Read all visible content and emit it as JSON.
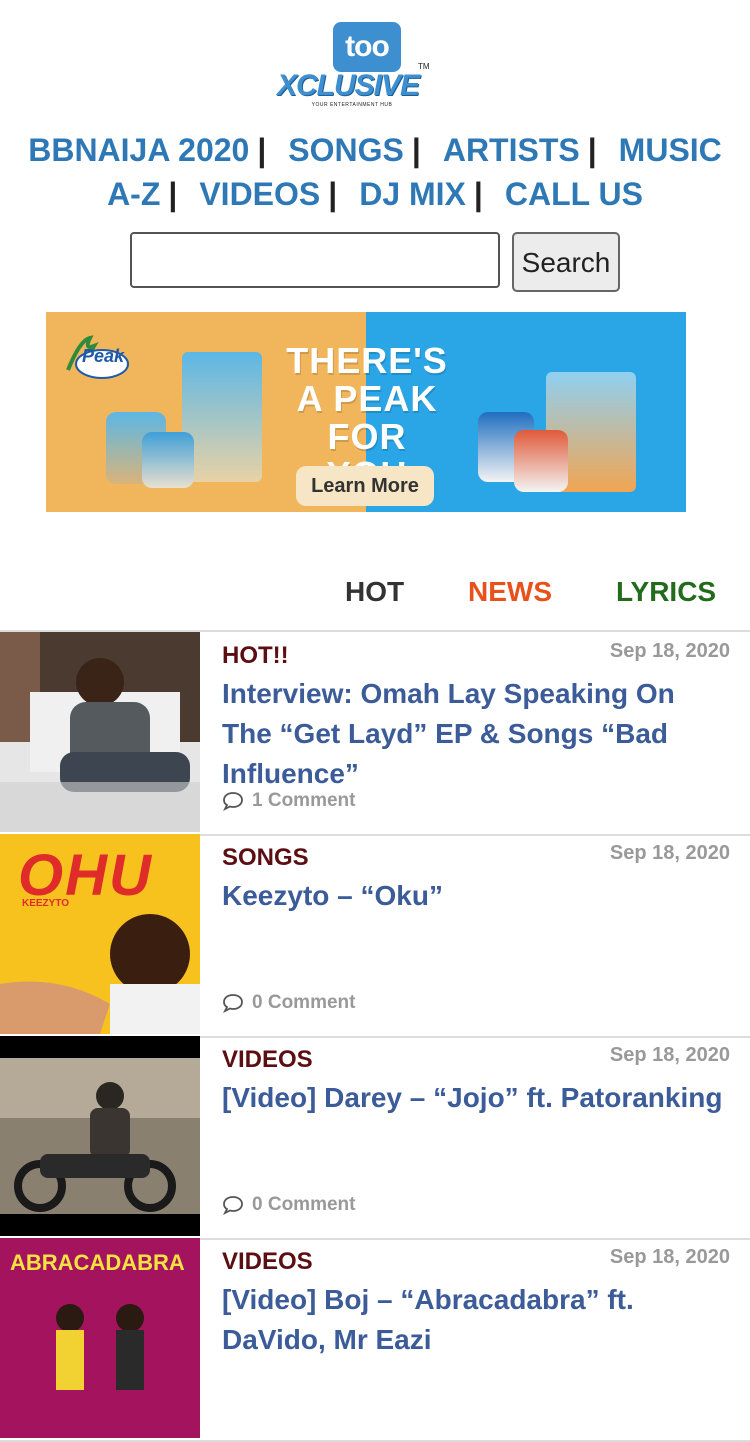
{
  "logo": {
    "top_text": "too",
    "main_text": "XCLUSIVE",
    "tm": "TM",
    "tagline": "YOUR ENTERTAINMENT HUB"
  },
  "nav": {
    "items": [
      "BBNAIJA 2020",
      "SONGS",
      "ARTISTS",
      "MUSIC A-Z",
      "VIDEOS",
      "DJ MIX",
      "CALL US"
    ],
    "line1": [
      "BBNAIJA 2020",
      "SONGS",
      "ARTISTS",
      "MUSIC"
    ],
    "line2": [
      "A-Z",
      "VIDEOS",
      "DJ MIX",
      "CALL US"
    ],
    "separator": "|"
  },
  "search": {
    "placeholder": "",
    "value": "",
    "button_label": "Search"
  },
  "banner": {
    "brand": "Peak",
    "headline_1": "THERE'S",
    "headline_2": "A PEAK",
    "headline_3": "FOR YOU",
    "cta": "Learn More",
    "colors": {
      "left": "#f1b65c",
      "right": "#2aa5e6"
    }
  },
  "tabs": [
    {
      "label": "HOT",
      "color": "#333333"
    },
    {
      "label": "NEWS",
      "color": "#e8501c"
    },
    {
      "label": "LYRICS",
      "color": "#226b1c"
    }
  ],
  "posts": [
    {
      "category": "HOT!!",
      "date": "Sep 18, 2020",
      "title": "Interview: Omah Lay Speaking On The “Get Layd” EP & Songs “Bad Influence”",
      "comments": "1 Comment"
    },
    {
      "category": "SONGS",
      "date": "Sep 18, 2020",
      "title": "Keezyto – “Oku”",
      "comments": "0 Comment",
      "thumb_text": "OHU",
      "thumb_sub": "KEEZYTO"
    },
    {
      "category": "VIDEOS",
      "date": "Sep 18, 2020",
      "title": "[Video] Darey – “Jojo” ft. Patoranking",
      "comments": "0 Comment"
    },
    {
      "category": "VIDEOS",
      "date": "Sep 18, 2020",
      "title": "[Video] Boj – “Abracadabra” ft. DaVido, Mr Eazi",
      "comments": "",
      "thumb_text": "ABRACADABRA"
    }
  ]
}
